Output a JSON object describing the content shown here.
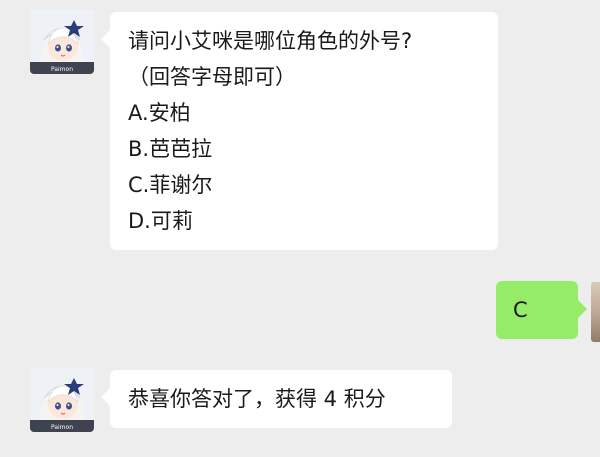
{
  "messages": [
    {
      "sender": "bot",
      "lines": [
        "请问小艾咪是哪位角色的外号?",
        "（回答字母即可）",
        "A.安柏",
        "B.芭芭拉",
        "C.菲谢尔",
        "D.可莉"
      ]
    },
    {
      "sender": "user",
      "text": "C"
    },
    {
      "sender": "bot",
      "text": "恭喜你答对了，获得 4 积分"
    }
  ],
  "avatar_badge": "Paimon",
  "colors": {
    "background": "#ededed",
    "bubble_received": "#ffffff",
    "bubble_sent": "#95ec69",
    "text": "#1a1a1a"
  }
}
